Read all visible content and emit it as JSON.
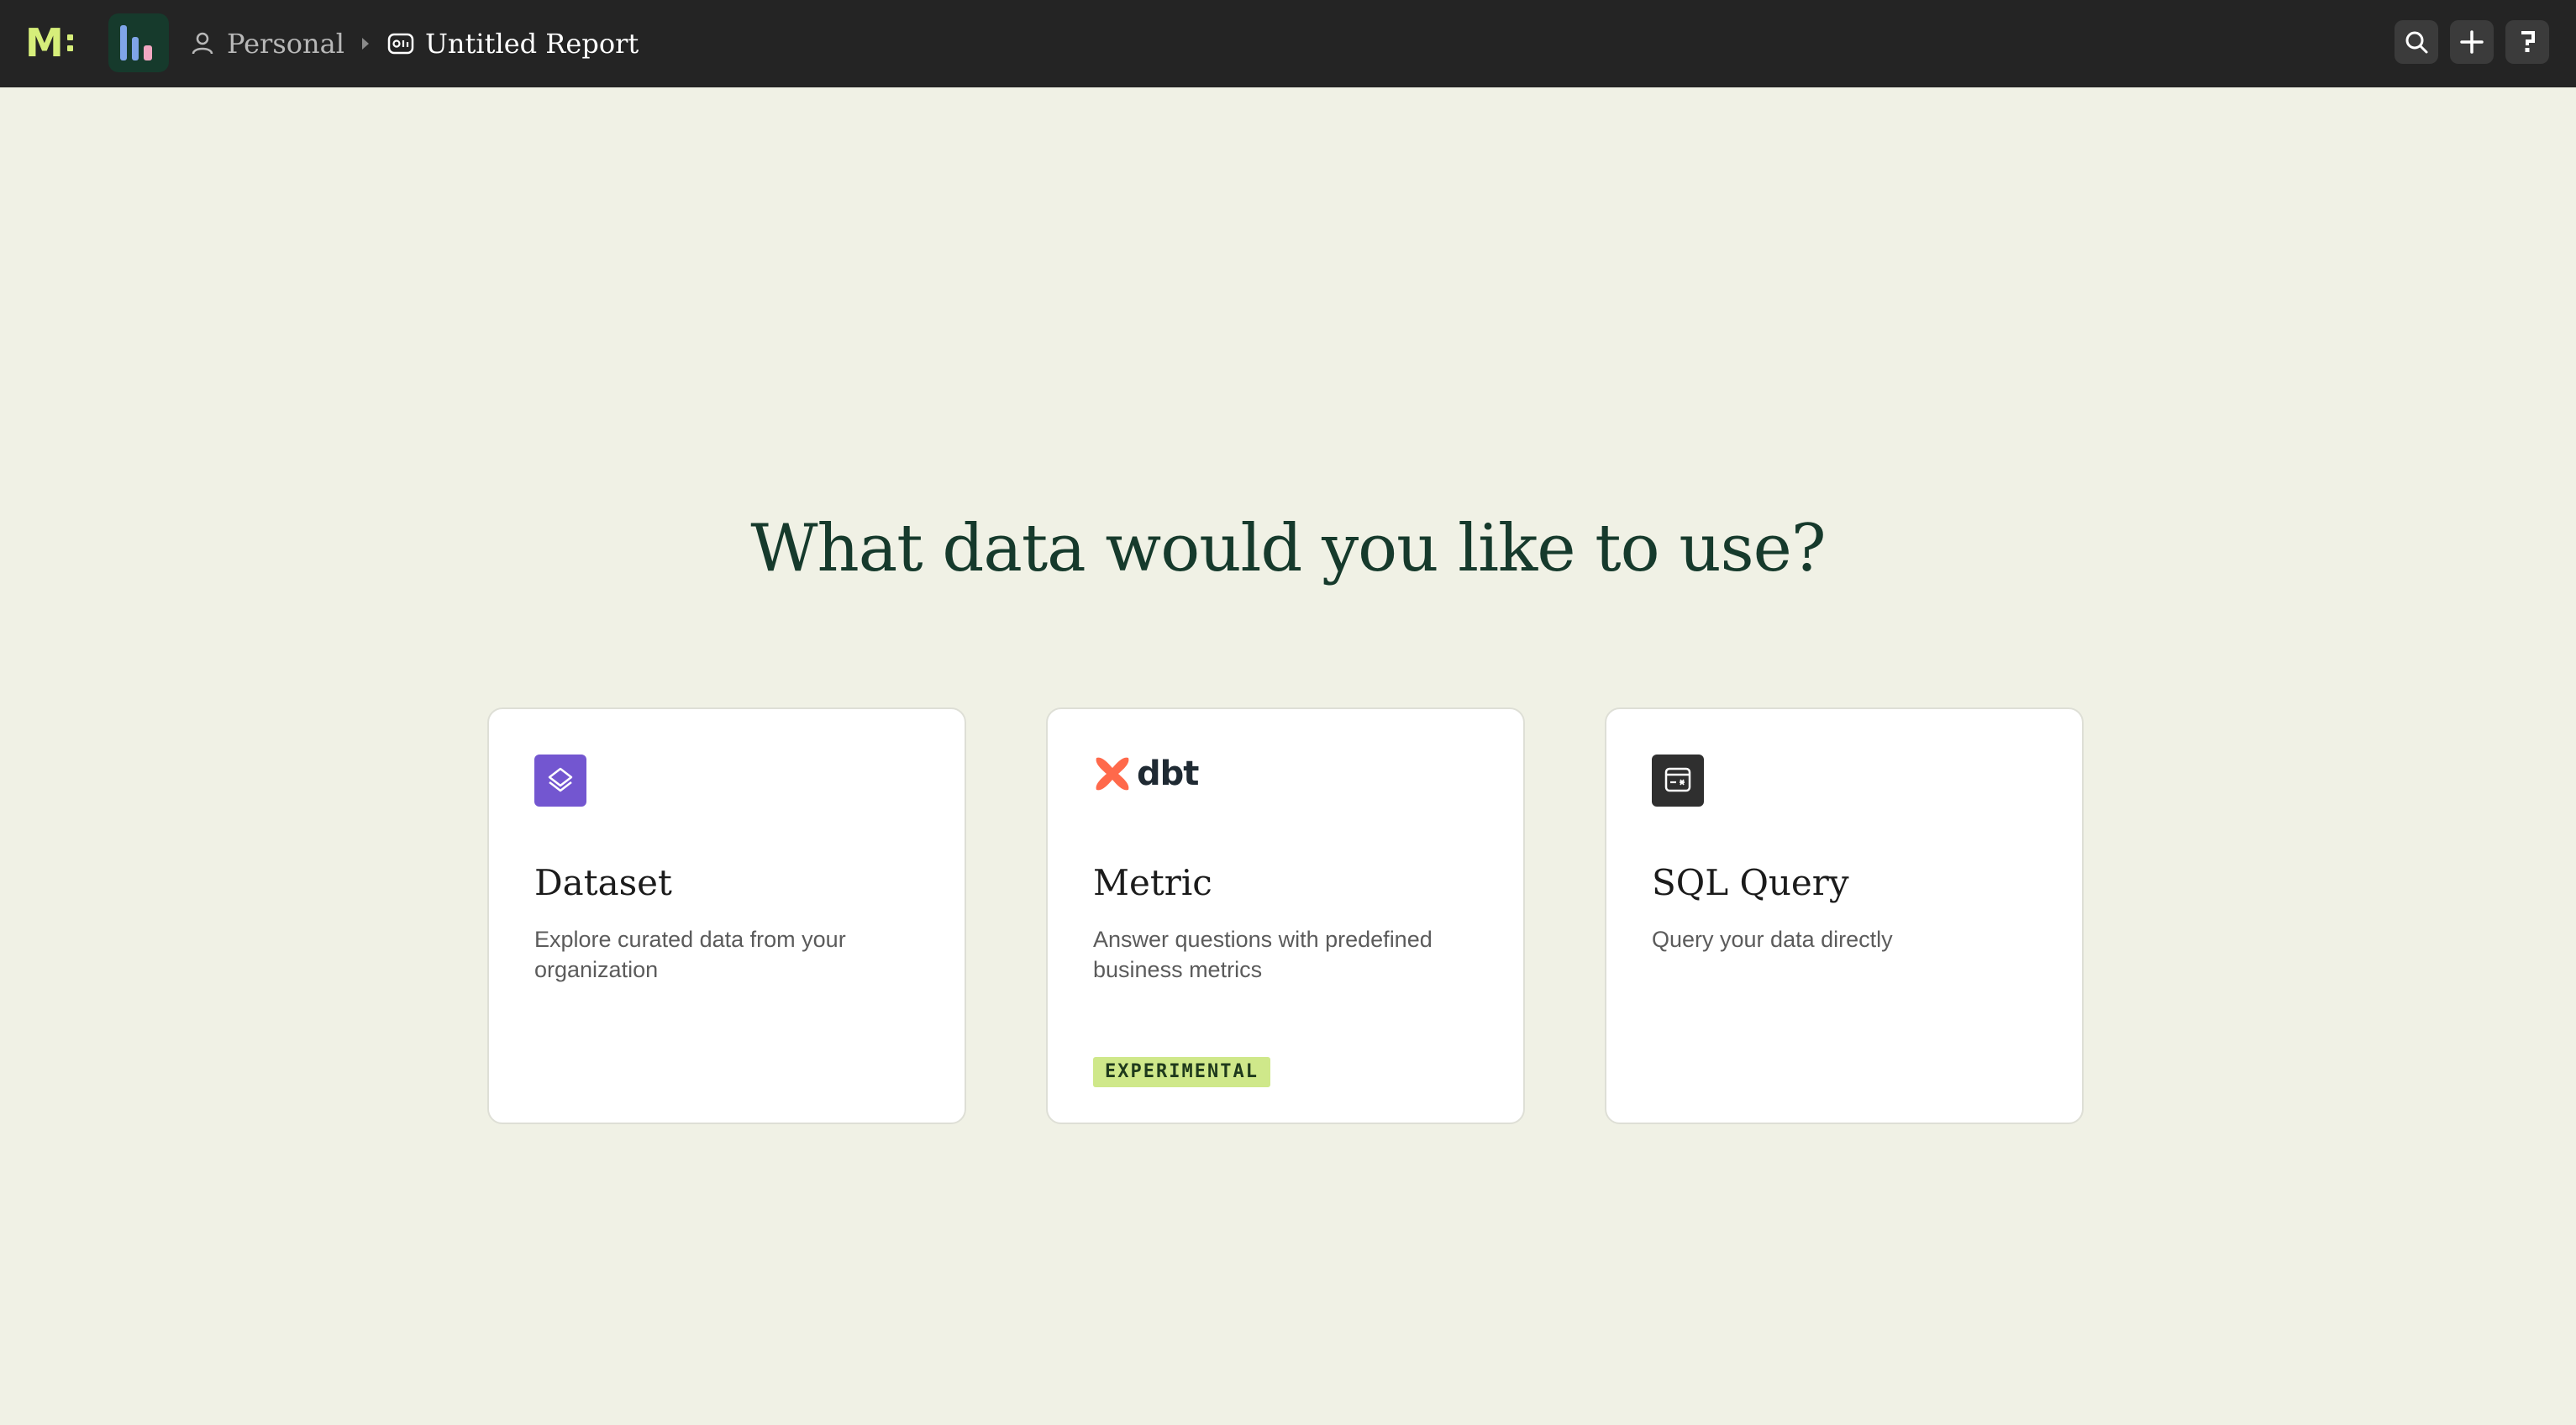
{
  "header": {
    "logo_letter": "M",
    "breadcrumb": [
      {
        "label": "Personal",
        "icon": "person-icon"
      },
      {
        "label": "Untitled Report",
        "icon": "report-icon"
      }
    ],
    "actions": [
      {
        "icon": "search-icon"
      },
      {
        "icon": "plus-icon"
      },
      {
        "icon": "help-icon"
      }
    ]
  },
  "main": {
    "headline": "What data would you like to use?",
    "cards": [
      {
        "title": "Dataset",
        "description": "Explore curated data from your organization",
        "icon": "dataset-icon",
        "icon_color": "#7356d0"
      },
      {
        "title": "Metric",
        "description": "Answer questions with predefined business metrics",
        "icon": "dbt-logo",
        "logo_text": "dbt",
        "badge": "EXPERIMENTAL",
        "icon_color": "#ff694b"
      },
      {
        "title": "SQL Query",
        "description": "Query your data directly",
        "icon": "sql-query-icon",
        "icon_color": "#2f2f2f"
      }
    ]
  },
  "colors": {
    "topbar": "#242424",
    "background": "#f0f1e5",
    "accent": "#d6ee7a",
    "headline": "#163a2c",
    "badge_bg": "#cfe88a"
  }
}
